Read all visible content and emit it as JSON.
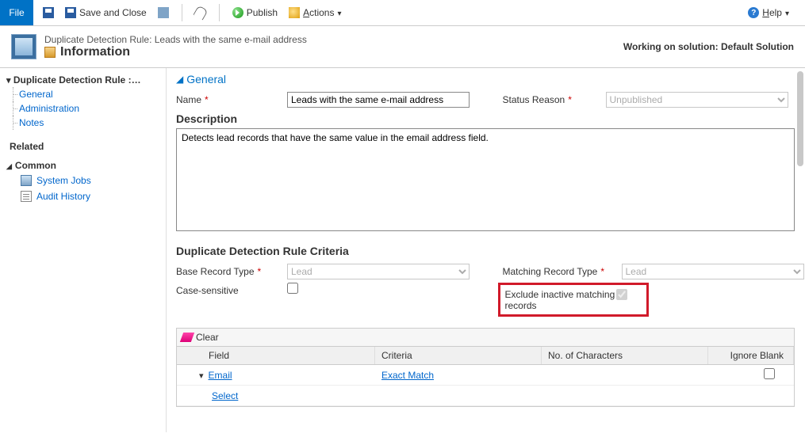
{
  "ribbon": {
    "file": "File",
    "save_close": "Save and Close",
    "publish": "Publish",
    "actions": "Actions",
    "help": "Help"
  },
  "header": {
    "entity_title": "Duplicate Detection Rule: Leads with the same e-mail address",
    "form_name": "Information",
    "solution": "Working on solution: Default Solution"
  },
  "sidebar": {
    "breadcrumb": "Duplicate Detection Rule :…",
    "items": [
      "General",
      "Administration",
      "Notes"
    ],
    "related": "Related",
    "common": "Common",
    "common_items": [
      "System Jobs",
      "Audit History"
    ]
  },
  "section": {
    "general": "General"
  },
  "fields": {
    "name_label": "Name",
    "name_value": "Leads with the same e-mail address",
    "status_label": "Status Reason",
    "status_value": "Unpublished",
    "description_label": "Description",
    "description_value": "Detects lead records that have the same value in the email address field.",
    "criteria_title": "Duplicate Detection Rule Criteria",
    "base_type_label": "Base Record Type",
    "base_type_value": "Lead",
    "match_type_label": "Matching Record Type",
    "match_type_value": "Lead",
    "case_label": "Case-sensitive",
    "exclude_label": "Exclude inactive matching records"
  },
  "grid": {
    "clear": "Clear",
    "head_field": "Field",
    "head_criteria": "Criteria",
    "head_chars": "No. of Characters",
    "head_ignore": "Ignore Blank",
    "row1_field": "Email",
    "row1_criteria": "Exact Match",
    "row2_select": "Select"
  }
}
